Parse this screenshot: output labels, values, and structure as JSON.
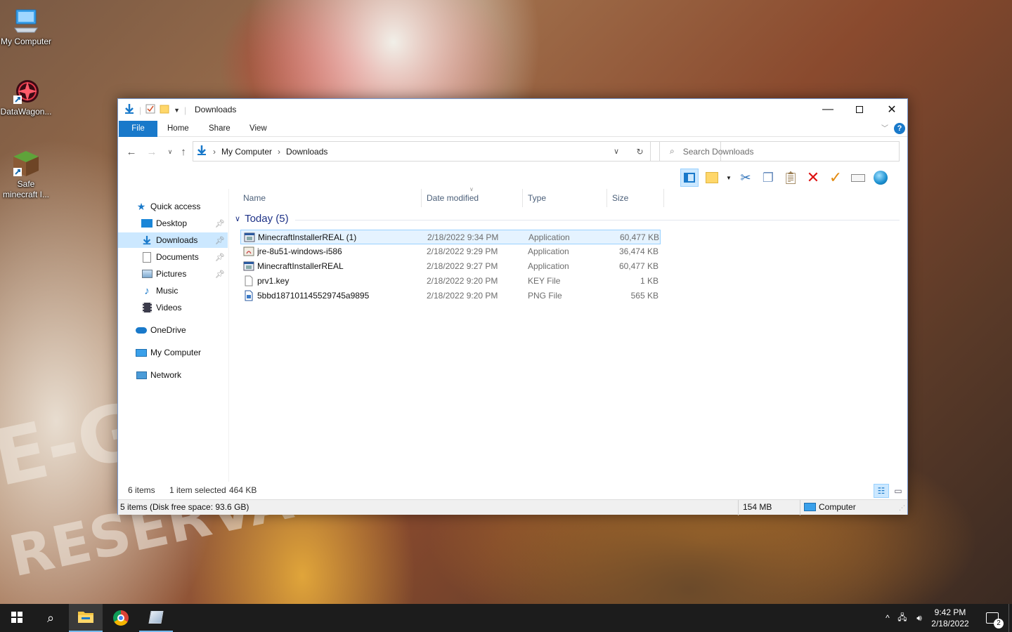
{
  "desktop": {
    "icons": [
      {
        "label": "My Computer"
      },
      {
        "label": "DataWagon..."
      },
      {
        "label": "Safe minecraft I..."
      }
    ]
  },
  "window": {
    "title": "Downloads",
    "tabs": {
      "file": "File",
      "home": "Home",
      "share": "Share",
      "view": "View"
    },
    "breadcrumb": [
      "My Computer",
      "Downloads"
    ],
    "search_placeholder": "Search Downloads",
    "nav": {
      "quick_access": "Quick access",
      "desktop": "Desktop",
      "downloads": "Downloads",
      "documents": "Documents",
      "pictures": "Pictures",
      "music": "Music",
      "videos": "Videos",
      "onedrive": "OneDrive",
      "my_computer": "My Computer",
      "network": "Network"
    },
    "columns": {
      "name": "Name",
      "date": "Date modified",
      "type": "Type",
      "size": "Size"
    },
    "group_label": "Today (5)",
    "files": [
      {
        "name": "MinecraftInstallerREAL (1)",
        "date": "2/18/2022 9:34 PM",
        "type": "Application",
        "size": "60,477 KB"
      },
      {
        "name": "jre-8u51-windows-i586",
        "date": "2/18/2022 9:29 PM",
        "type": "Application",
        "size": "36,474 KB"
      },
      {
        "name": "MinecraftInstallerREAL",
        "date": "2/18/2022 9:27 PM",
        "type": "Application",
        "size": "60,477 KB"
      },
      {
        "name": "prv1.key",
        "date": "2/18/2022 9:20 PM",
        "type": "KEY File",
        "size": "1 KB"
      },
      {
        "name": "5bbd187101145529745a9895",
        "date": "2/18/2022 9:20 PM",
        "type": "PNG File",
        "size": "565 KB"
      }
    ],
    "status": {
      "items": "6 items",
      "selected": "1 item selected",
      "selected_size": "464 KB",
      "disk_info": "5 items (Disk free space: 93.6 GB)",
      "size_total": "154 MB",
      "location": "Computer"
    }
  },
  "taskbar": {
    "time": "9:42 PM",
    "date": "2/18/2022",
    "notifications": "2"
  },
  "colors": {
    "accent": "#1979ca",
    "selection": "#cce8ff",
    "taskbar": "#1c1c1c"
  }
}
